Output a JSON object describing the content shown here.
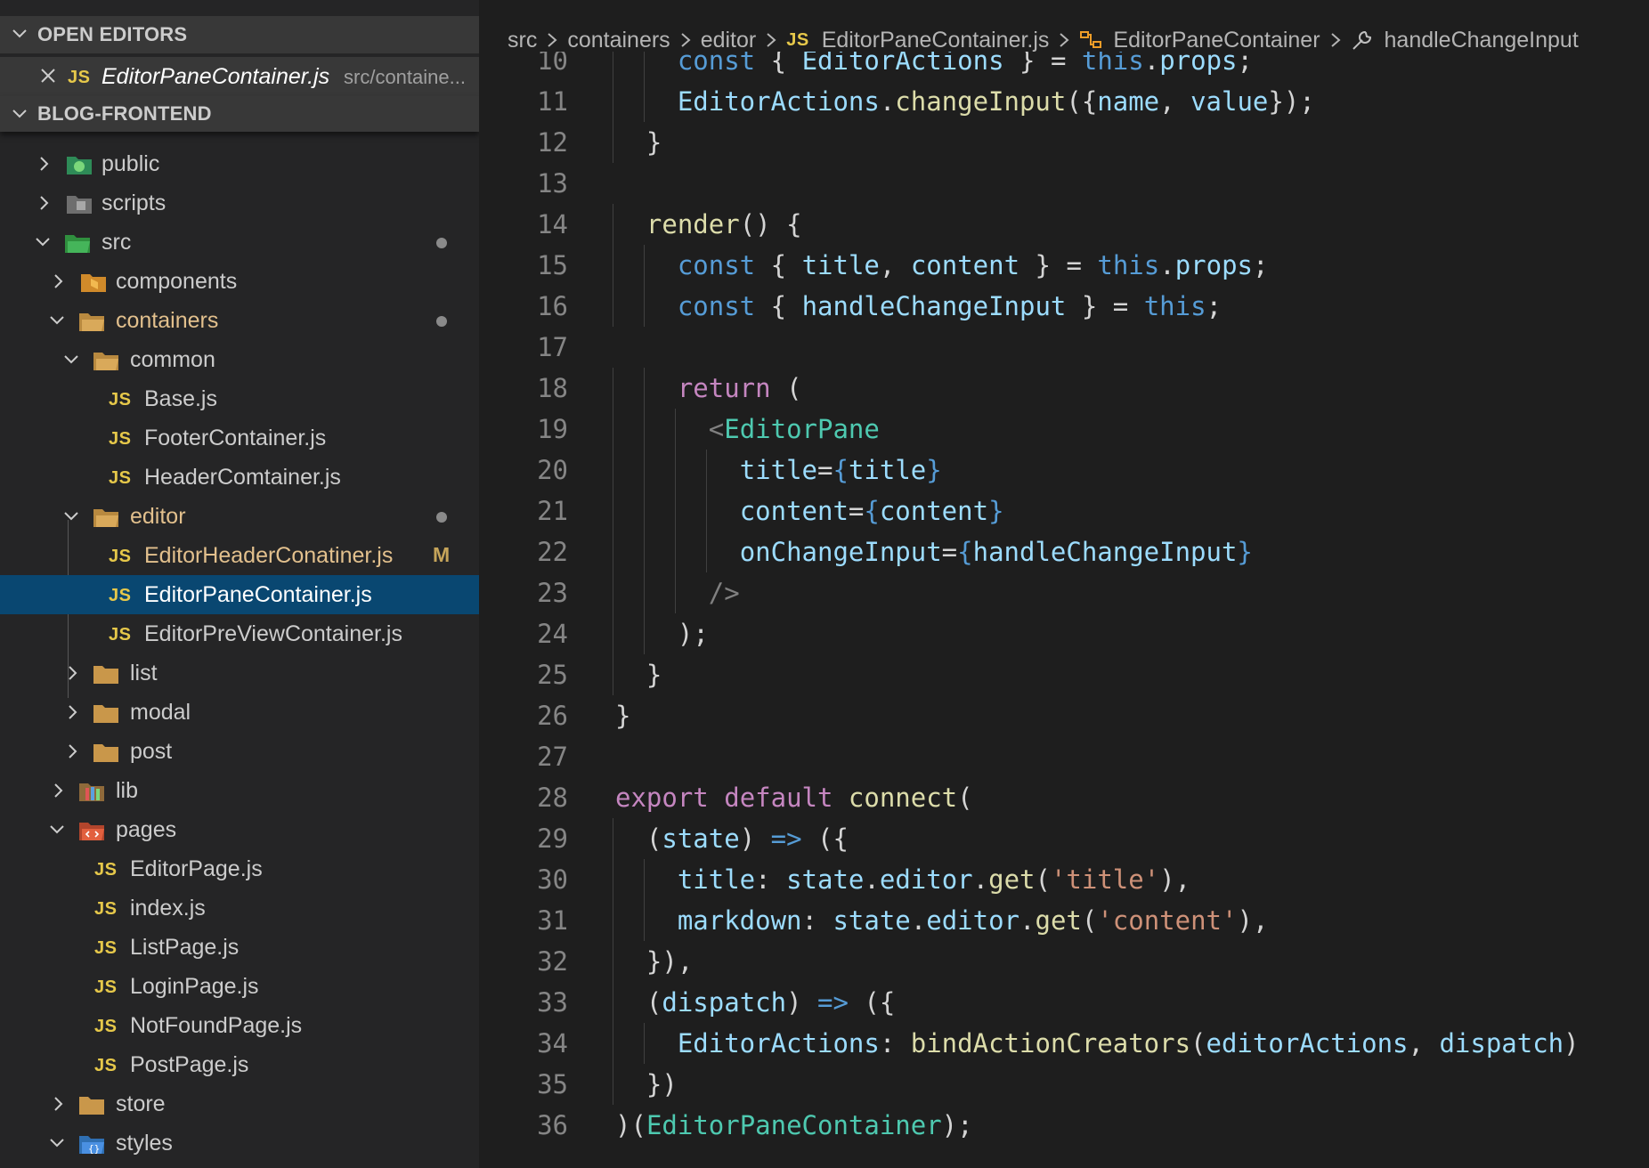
{
  "explorer": {
    "open_editors_title": "OPEN EDITORS",
    "open_editor": {
      "badge": "JS",
      "file": "EditorPaneContainer.js",
      "path": "src/containe..."
    },
    "project_title": "BLOG-FRONTEND",
    "tree": [
      {
        "label": "public",
        "type": "folder",
        "expanded": false,
        "icon": "public-folder-icon"
      },
      {
        "label": "scripts",
        "type": "folder",
        "expanded": false,
        "icon": "scripts-folder-icon"
      },
      {
        "label": "src",
        "type": "folder",
        "expanded": true,
        "icon": "src-folder-icon",
        "modified_dot": true
      },
      {
        "label": "components",
        "type": "folder",
        "expanded": false,
        "icon": "components-folder-icon"
      },
      {
        "label": "containers",
        "type": "folder",
        "expanded": true,
        "icon": "folder-open-icon",
        "modified_dot": true
      },
      {
        "label": "common",
        "type": "folder",
        "expanded": true,
        "icon": "folder-open-icon"
      },
      {
        "label": "Base.js",
        "type": "file",
        "badge": "JS"
      },
      {
        "label": "FooterContainer.js",
        "type": "file",
        "badge": "JS"
      },
      {
        "label": "HeaderComtainer.js",
        "type": "file",
        "badge": "JS"
      },
      {
        "label": "editor",
        "type": "folder",
        "expanded": true,
        "icon": "folder-open-icon",
        "modified_dot": true
      },
      {
        "label": "EditorHeaderConatiner.js",
        "type": "file",
        "badge": "JS",
        "status": "M"
      },
      {
        "label": "EditorPaneContainer.js",
        "type": "file",
        "badge": "JS",
        "selected": true
      },
      {
        "label": "EditorPreViewContainer.js",
        "type": "file",
        "badge": "JS"
      },
      {
        "label": "list",
        "type": "folder",
        "expanded": false,
        "icon": "folder-icon"
      },
      {
        "label": "modal",
        "type": "folder",
        "expanded": false,
        "icon": "folder-icon"
      },
      {
        "label": "post",
        "type": "folder",
        "expanded": false,
        "icon": "folder-icon"
      },
      {
        "label": "lib",
        "type": "folder",
        "expanded": false,
        "icon": "lib-folder-icon"
      },
      {
        "label": "pages",
        "type": "folder",
        "expanded": true,
        "icon": "pages-folder-icon"
      },
      {
        "label": "EditorPage.js",
        "type": "file",
        "badge": "JS"
      },
      {
        "label": "index.js",
        "type": "file",
        "badge": "JS"
      },
      {
        "label": "ListPage.js",
        "type": "file",
        "badge": "JS"
      },
      {
        "label": "LoginPage.js",
        "type": "file",
        "badge": "JS"
      },
      {
        "label": "NotFoundPage.js",
        "type": "file",
        "badge": "JS"
      },
      {
        "label": "PostPage.js",
        "type": "file",
        "badge": "JS"
      },
      {
        "label": "store",
        "type": "folder",
        "expanded": false,
        "icon": "folder-icon"
      },
      {
        "label": "styles",
        "type": "folder",
        "expanded": true,
        "icon": "styles-folder-icon"
      }
    ]
  },
  "breadcrumb": {
    "items": [
      "src",
      "containers",
      "editor"
    ],
    "file_badge": "JS",
    "file": "EditorPaneContainer.js",
    "class_name": "EditorPaneContainer",
    "method": "handleChangeInput"
  },
  "editor": {
    "lines": [
      {
        "n": "10",
        "text": "    const { EditorActions } = this.props;"
      },
      {
        "n": "11",
        "text": "    EditorActions.changeInput({name, value});"
      },
      {
        "n": "12",
        "text": "  }"
      },
      {
        "n": "13",
        "text": ""
      },
      {
        "n": "14",
        "text": "  render() {"
      },
      {
        "n": "15",
        "text": "    const { title, content } = this.props;"
      },
      {
        "n": "16",
        "text": "    const { handleChangeInput } = this;"
      },
      {
        "n": "17",
        "text": ""
      },
      {
        "n": "18",
        "text": "    return ("
      },
      {
        "n": "19",
        "text": "      <EditorPane"
      },
      {
        "n": "20",
        "text": "        title={title}"
      },
      {
        "n": "21",
        "text": "        content={content}"
      },
      {
        "n": "22",
        "text": "        onChangeInput={handleChangeInput}"
      },
      {
        "n": "23",
        "text": "      />"
      },
      {
        "n": "24",
        "text": "    );"
      },
      {
        "n": "25",
        "text": "  }"
      },
      {
        "n": "26",
        "text": "}"
      },
      {
        "n": "27",
        "text": ""
      },
      {
        "n": "28",
        "text": "export default connect("
      },
      {
        "n": "29",
        "text": "  (state) => ({"
      },
      {
        "n": "30",
        "text": "    title: state.editor.get('title'),"
      },
      {
        "n": "31",
        "text": "    markdown: state.editor.get('content'),"
      },
      {
        "n": "32",
        "text": "  }),"
      },
      {
        "n": "33",
        "text": "  (dispatch) => ({"
      },
      {
        "n": "34",
        "text": "    EditorActions: bindActionCreators(editorActions, dispatch)"
      },
      {
        "n": "35",
        "text": "  })"
      },
      {
        "n": "36",
        "text": ")(EditorPaneContainer);"
      }
    ]
  },
  "colors": {
    "keyword": "#569cd6",
    "control": "#c586c0",
    "variable": "#9cdcfe",
    "function": "#dcdcaa",
    "component": "#4ec9b0",
    "string": "#ce9178",
    "selection": "#094771",
    "js_badge": "#e6c84a",
    "modified": "#c5a45a"
  }
}
